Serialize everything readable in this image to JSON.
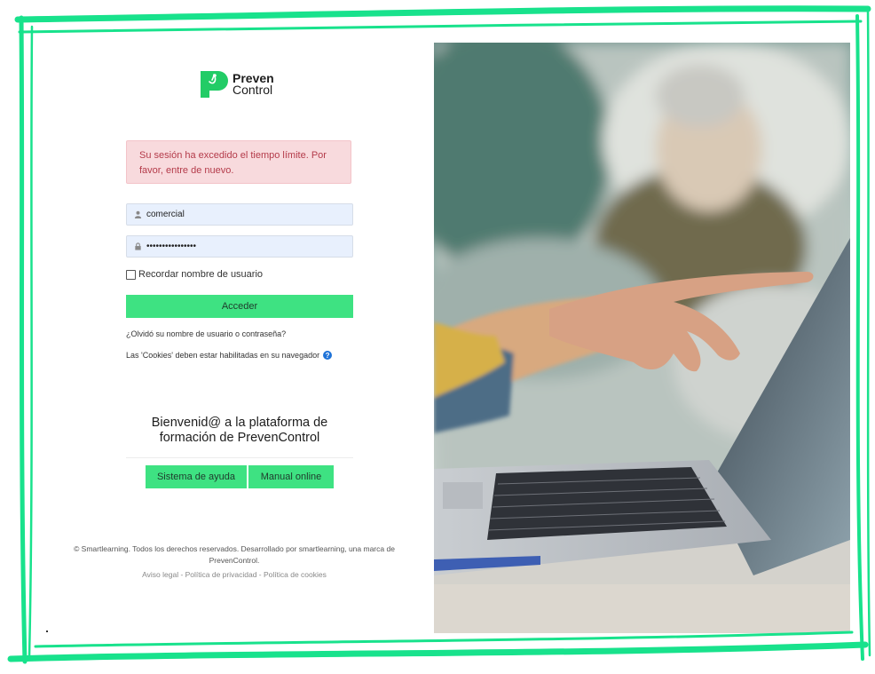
{
  "brand": {
    "name_line1": "Preven",
    "name_line2": "Control",
    "color": "#22cc66"
  },
  "login": {
    "alert_text": "Su sesión ha excedido el tiempo límite. Por favor, entre de nuevo.",
    "username_value": "comercial",
    "password_value": "••••••••••••••••",
    "remember_label": "Recordar nombre de usuario",
    "submit_label": "Acceder",
    "forgot_link": "¿Olvidó su nombre de usuario o contraseña?",
    "cookies_notice": "Las 'Cookies' deben estar habilitadas en su navegador"
  },
  "welcome": {
    "line1": "Bienvenid@ a la plataforma de",
    "line2": "formación de PrevenControl"
  },
  "help_buttons": {
    "help_system": "Sistema de ayuda",
    "manual_online": "Manual online"
  },
  "footer": {
    "copyright": "© Smartlearning. Todos los derechos reservados. Desarrollado por smartlearning, una marca de PrevenControl.",
    "links": "Aviso legal - Política de privacidad - Política de cookies"
  },
  "icons": {
    "user": "user-icon",
    "lock": "lock-icon",
    "help": "question-circle-icon"
  },
  "colors": {
    "accent": "#3ee282",
    "alert_bg": "#f8dadd",
    "alert_text": "#b43b4a",
    "frame": "#17e08a"
  }
}
